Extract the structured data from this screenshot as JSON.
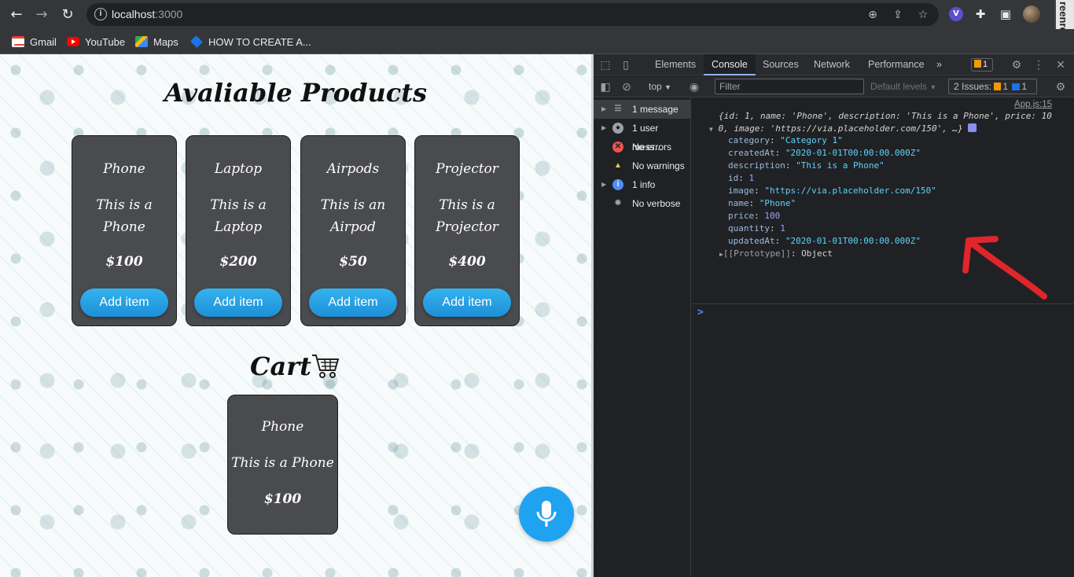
{
  "browser": {
    "url_host": "localhost",
    "url_port": ":3000",
    "bookmarks": [
      "Gmail",
      "YouTube",
      "Maps",
      "HOW TO CREATE A..."
    ],
    "screenrec_label": "reenrec"
  },
  "page": {
    "title": "Avaliable Products",
    "products": [
      {
        "name": "Phone",
        "description": "This is a Phone",
        "price": "$100",
        "button": "Add item"
      },
      {
        "name": "Laptop",
        "description": "This is a Laptop",
        "price": "$200",
        "button": "Add item"
      },
      {
        "name": "Airpods",
        "description": "This is an Airpod",
        "price": "$50",
        "button": "Add item"
      },
      {
        "name": "Projector",
        "description": "This is a Projector",
        "price": "$400",
        "button": "Add item"
      }
    ],
    "cart_title": "Cart",
    "cart_items": [
      {
        "name": "Phone",
        "description": "This is a Phone",
        "price": "$100"
      }
    ]
  },
  "devtools": {
    "tabs": [
      "Elements",
      "Console",
      "Sources",
      "Network",
      "Performance"
    ],
    "active_tab": "Console",
    "more_tabs": "»",
    "warn_count": "1",
    "context": "top",
    "filter_placeholder": "Filter",
    "levels": "Default levels",
    "issues_label": "2 Issues:",
    "issues_warn": "1",
    "issues_info": "1",
    "sidebar": [
      {
        "label": "1 message",
        "icon": "list-icon",
        "color": "#9aa0a6",
        "expandable": true,
        "selected": true
      },
      {
        "label": "1 user mess...",
        "icon": "user-icon",
        "color": "#9aa0a6",
        "expandable": true,
        "selected": false
      },
      {
        "label": "No errors",
        "icon": "error-icon",
        "color": "#ef5350",
        "expandable": false,
        "selected": false
      },
      {
        "label": "No warnings",
        "icon": "warning-icon",
        "color": "#f2c94c",
        "expandable": false,
        "selected": false
      },
      {
        "label": "1 info",
        "icon": "info-icon",
        "color": "#4e8ef7",
        "expandable": true,
        "selected": false
      },
      {
        "label": "No verbose",
        "icon": "bug-icon",
        "color": "#9aa0a6",
        "expandable": false,
        "selected": false
      }
    ],
    "console": {
      "source": "App.js:15",
      "summary_line1": "{id: 1, name: 'Phone', description: 'This is a Phone', price: 10",
      "summary_line2": "0, image: 'https://via.placeholder.com/150', …}",
      "props": [
        {
          "key": "category",
          "value": "\"Category 1\"",
          "kind": "str"
        },
        {
          "key": "createdAt",
          "value": "\"2020-01-01T00:00:00.000Z\"",
          "kind": "str"
        },
        {
          "key": "description",
          "value": "\"This is a Phone\"",
          "kind": "str"
        },
        {
          "key": "id",
          "value": "1",
          "kind": "num"
        },
        {
          "key": "image",
          "value": "\"https://via.placeholder.com/150\"",
          "kind": "str"
        },
        {
          "key": "name",
          "value": "\"Phone\"",
          "kind": "str"
        },
        {
          "key": "price",
          "value": "100",
          "kind": "num"
        },
        {
          "key": "quantity",
          "value": "1",
          "kind": "num"
        },
        {
          "key": "updatedAt",
          "value": "\"2020-01-01T00:00:00.000Z\"",
          "kind": "str"
        }
      ],
      "prototype_key": "[[Prototype]]",
      "prototype_value": "Object",
      "prompt": ">"
    },
    "annotation_color": "#e0262a"
  }
}
